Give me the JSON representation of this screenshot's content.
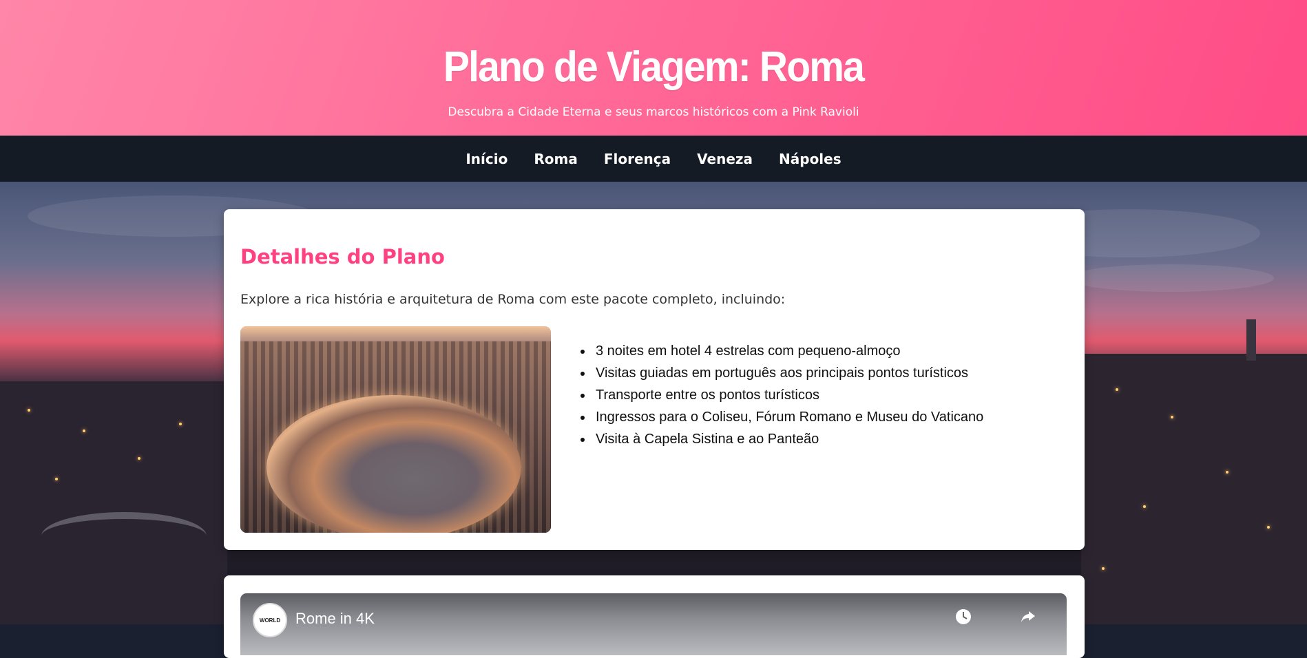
{
  "header": {
    "title": "Plano de Viagem: Roma",
    "subtitle": "Descubra a Cidade Eterna e seus marcos históricos com a Pink Ravioli"
  },
  "nav": {
    "items": [
      {
        "label": "Início"
      },
      {
        "label": "Roma"
      },
      {
        "label": "Florença"
      },
      {
        "label": "Veneza"
      },
      {
        "label": "Nápoles"
      }
    ]
  },
  "plan": {
    "heading": "Detalhes do Plano",
    "intro": "Explore a rica história e arquitetura de Roma com este pacote completo, incluindo:",
    "items": [
      "3 noites em hotel 4 estrelas com pequeno-almoço",
      "Visitas guiadas em português aos principais pontos turísticos",
      "Transporte entre os pontos turísticos",
      "Ingressos para o Coliseu, Fórum Romano e Museu do Vaticano",
      "Visita à Capela Sistina e ao Panteão"
    ]
  },
  "video": {
    "title": "Rome in 4K",
    "channel_avatar_text": "WORLD",
    "icons": [
      "watch-later-icon",
      "share-icon"
    ]
  },
  "colors": {
    "accent": "#ff4081",
    "header_gradient_start": "#ff86a8",
    "header_gradient_end": "#ff4c86",
    "nav_bg": "#141b24"
  }
}
